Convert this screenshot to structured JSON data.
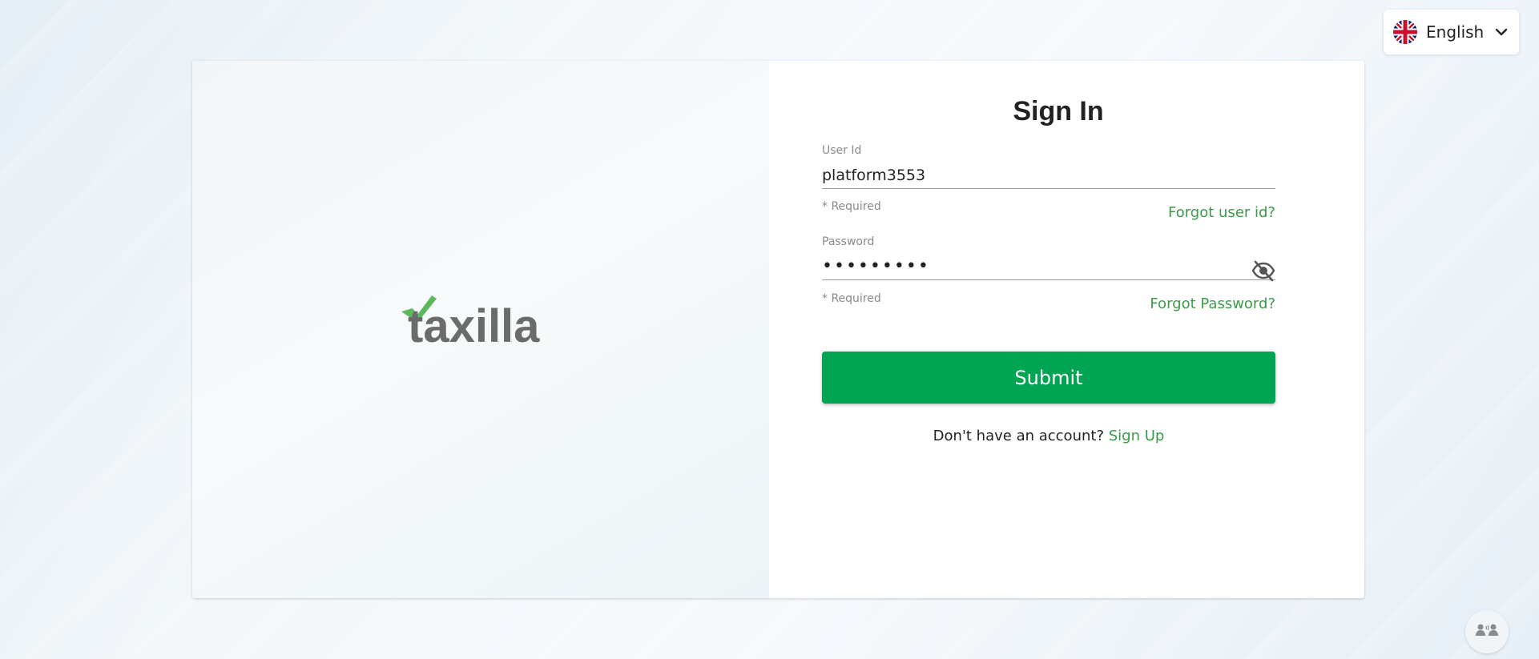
{
  "language": {
    "selected": "English",
    "flag_icon": "uk-flag-icon",
    "chevron_icon": "chevron-down-icon"
  },
  "brand": {
    "logo_text": "taxilla",
    "accent_color": "#00a453",
    "link_color": "#3a9b48"
  },
  "form": {
    "title": "Sign In",
    "user_id": {
      "label": "User Id",
      "value": "platform3553",
      "helper": "* Required",
      "forgot_link": "Forgot user id?"
    },
    "password": {
      "label": "Password",
      "value": "•••••••••",
      "helper": "* Required",
      "forgot_link": "Forgot Password?",
      "toggle_icon": "eye-off-icon"
    },
    "submit_label": "Submit",
    "signup_prompt": "Don't have an account?",
    "signup_link": "Sign Up"
  },
  "support": {
    "icon": "support-chat-icon"
  }
}
